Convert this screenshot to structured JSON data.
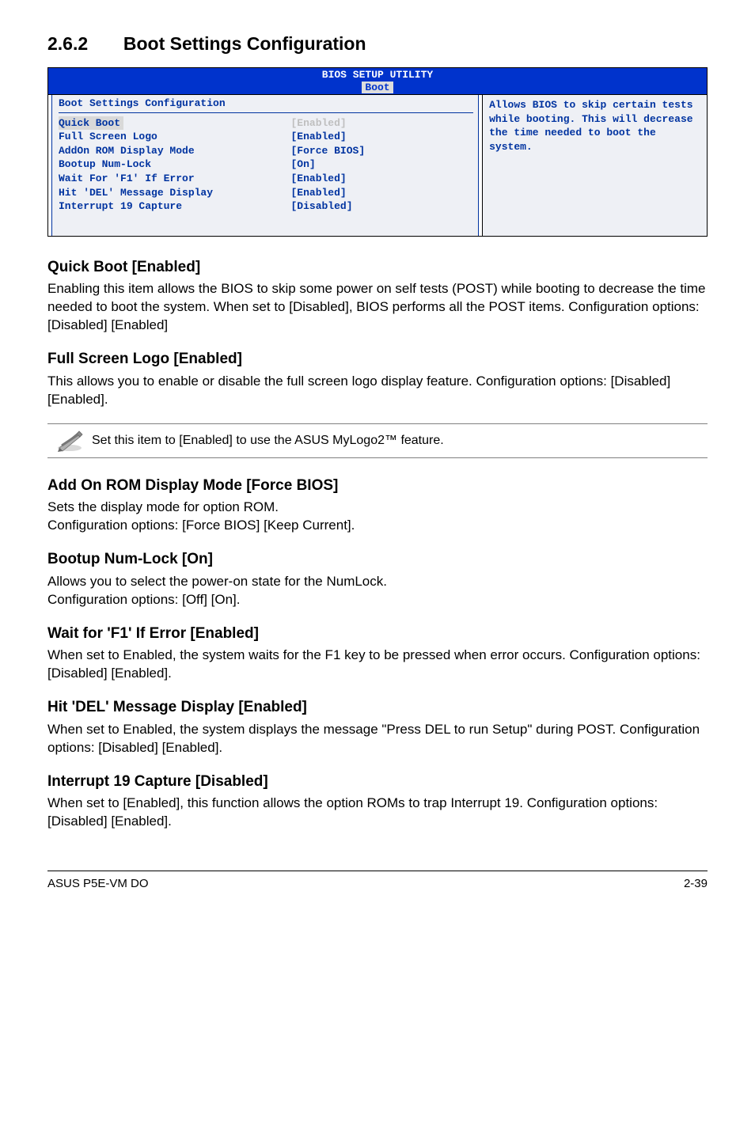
{
  "section": {
    "number": "2.6.2",
    "title": "Boot Settings Configuration"
  },
  "bios": {
    "titlebar": "BIOS SETUP UTILITY",
    "tab": "Boot",
    "panel_heading": "Boot Settings Configuration",
    "rows": [
      {
        "label": "Quick Boot",
        "value": "[Enabled]",
        "hl": true
      },
      {
        "label": "Full Screen Logo",
        "value": "[Enabled]"
      },
      {
        "label": "AddOn ROM Display Mode",
        "value": "[Force BIOS]"
      },
      {
        "label": "Bootup Num-Lock",
        "value": "[On]"
      },
      {
        "label": "Wait For 'F1' If Error",
        "value": "[Enabled]"
      },
      {
        "label": "Hit 'DEL' Message Display",
        "value": "[Enabled]"
      },
      {
        "label": "Interrupt 19 Capture",
        "value": "[Disabled]"
      }
    ],
    "help": "Allows BIOS to skip certain tests while booting. This will decrease the time needed to boot the system."
  },
  "items": {
    "quickboot": {
      "heading": "Quick Boot [Enabled]",
      "body": "Enabling this item allows the BIOS to skip some power on self tests (POST) while booting to decrease the time needed to boot the system. When set to [Disabled], BIOS performs all the POST items. Configuration options: [Disabled] [Enabled]"
    },
    "fullscreen": {
      "heading": "Full Screen Logo [Enabled]",
      "body": "This allows you to enable or disable the full screen logo display feature. Configuration options: [Disabled] [Enabled]."
    },
    "note": "Set this item to [Enabled] to use the ASUS MyLogo2™ feature.",
    "addon": {
      "heading": "Add On ROM Display Mode [Force BIOS]",
      "body": "Sets the display mode for option ROM.\nConfiguration options: [Force BIOS] [Keep Current]."
    },
    "numlock": {
      "heading": "Bootup Num-Lock [On]",
      "body": "Allows you to select the power-on state for the NumLock.\nConfiguration options: [Off] [On]."
    },
    "waitf1": {
      "heading": "Wait for 'F1' If Error [Enabled]",
      "body": "When set to Enabled, the system waits for the F1 key to be pressed when error occurs. Configuration options: [Disabled] [Enabled]."
    },
    "hitdel": {
      "heading": "Hit 'DEL' Message Display [Enabled]",
      "body": "When set to Enabled, the system displays the message \"Press DEL to run Setup\" during POST. Configuration options: [Disabled] [Enabled]."
    },
    "int19": {
      "heading": "Interrupt 19 Capture [Disabled]",
      "body": "When set to [Enabled], this function allows the option ROMs to trap Interrupt 19. Configuration options: [Disabled] [Enabled]."
    }
  },
  "footer": {
    "left": "ASUS P5E-VM DO",
    "right": "2-39"
  }
}
